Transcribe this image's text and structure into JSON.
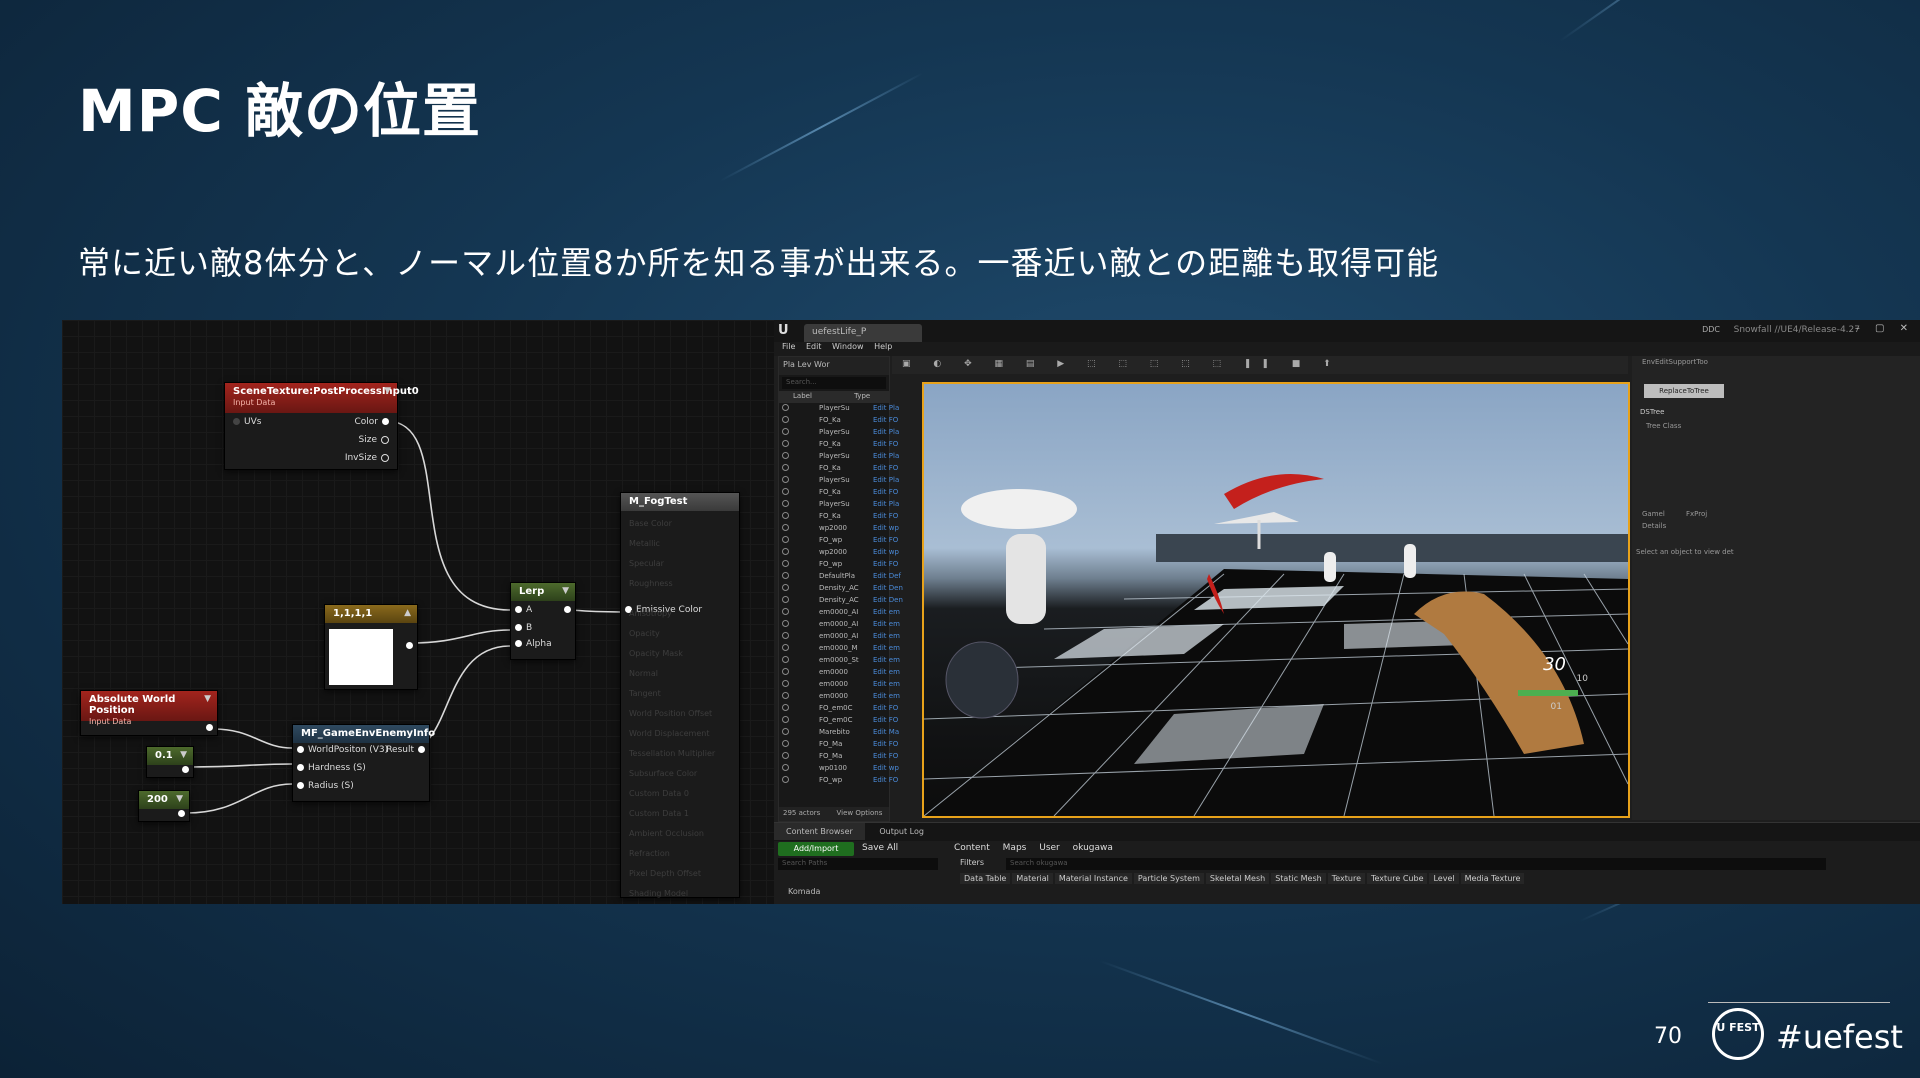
{
  "slide": {
    "title": "MPC 敵の位置",
    "subtitle": "常に近い敵8体分と、ノーマル位置8か所を知る事が出来る。一番近い敵との距離も取得可能",
    "page_number": "70",
    "hashtag": "#uefest",
    "logo_text": "U FEST"
  },
  "material_editor": {
    "scene_texture": {
      "title": "SceneTexture:PostProcessInput0",
      "subtitle": "Input Data",
      "in_uvs": "UVs",
      "out_color": "Color",
      "out_size": "Size",
      "out_invsize": "InvSize"
    },
    "constant_vec": {
      "title": "1,1,1,1"
    },
    "lerp": {
      "title": "Lerp",
      "pin_a": "A",
      "pin_b": "B",
      "pin_alpha": "Alpha"
    },
    "fog_material": {
      "title": "M_FogTest",
      "emissive": "Emissive Color",
      "dim_pins": [
        "Base Color",
        "Metallic",
        "Specular",
        "Roughness",
        "Anisotropy",
        "Opacity",
        "Opacity Mask",
        "Normal",
        "Tangent",
        "World Position Offset",
        "World Displacement",
        "Tessellation Multiplier",
        "Subsurface Color",
        "Custom Data 0",
        "Custom Data 1",
        "Ambient Occlusion",
        "Refraction",
        "Pixel Depth Offset",
        "Shading Model"
      ]
    },
    "absolute_world_position": {
      "title": "Absolute World Position",
      "subtitle": "Input Data"
    },
    "mf_enemy_info": {
      "title": "MF_GameEnvEnemyInfo",
      "pin_world_pos": "WorldPositon (V3)",
      "pin_result": "Result",
      "pin_hardness": "Hardness (S)",
      "pin_radius": "Radius (S)"
    },
    "const_hardness": "0.1",
    "const_radius": "200"
  },
  "ue_editor": {
    "logo": "U",
    "tab": "uefestLife_P",
    "release": "Snowfall //UE4/Release-4.27",
    "ddc": "DDC",
    "window_controls": "– ▢ ✕",
    "menu": [
      "File",
      "Edit",
      "Window",
      "Help"
    ],
    "outliner": {
      "toolbar": "Pla  Lev  Wor",
      "search_placeholder": "Search...",
      "col_label": "Label",
      "col_type": "Type",
      "rows": [
        {
          "label": "PlayerSu",
          "type": "Edit Pla"
        },
        {
          "label": "FO_Ka",
          "type": "Edit FO"
        },
        {
          "label": "PlayerSu",
          "type": "Edit Pla"
        },
        {
          "label": "FO_Ka",
          "type": "Edit FO"
        },
        {
          "label": "PlayerSu",
          "type": "Edit Pla"
        },
        {
          "label": "FO_Ka",
          "type": "Edit FO"
        },
        {
          "label": "PlayerSu",
          "type": "Edit Pla"
        },
        {
          "label": "FO_Ka",
          "type": "Edit FO"
        },
        {
          "label": "PlayerSu",
          "type": "Edit Pla"
        },
        {
          "label": "FO_Ka",
          "type": "Edit FO"
        },
        {
          "label": "wp2000",
          "type": "Edit wp"
        },
        {
          "label": "FO_wp",
          "type": "Edit FO"
        },
        {
          "label": "wp2000",
          "type": "Edit wp"
        },
        {
          "label": "FO_wp",
          "type": "Edit FO"
        },
        {
          "label": "DefaultPla",
          "type": "Edit Def"
        },
        {
          "label": "Density_AC",
          "type": "Edit Den"
        },
        {
          "label": "Density_AC",
          "type": "Edit Den"
        },
        {
          "label": "em0000_AI",
          "type": "Edit em"
        },
        {
          "label": "em0000_AI",
          "type": "Edit em"
        },
        {
          "label": "em0000_AI",
          "type": "Edit em"
        },
        {
          "label": "em0000_M",
          "type": "Edit em"
        },
        {
          "label": "em0000_St",
          "type": "Edit em"
        },
        {
          "label": "em0000",
          "type": "Edit em"
        },
        {
          "label": "em0000",
          "type": "Edit em"
        },
        {
          "label": "em0000",
          "type": "Edit em"
        },
        {
          "label": "FO_em0C",
          "type": "Edit FO"
        },
        {
          "label": "FO_em0C",
          "type": "Edit FO"
        },
        {
          "label": "Marebito",
          "type": "Edit Ma"
        },
        {
          "label": "FO_Ma",
          "type": "Edit FO"
        },
        {
          "label": "FO_Ma",
          "type": "Edit FO"
        },
        {
          "label": "wp0100",
          "type": "Edit wp"
        },
        {
          "label": "FO_wp",
          "type": "Edit FO"
        }
      ],
      "actor_count": "295 actors",
      "view_options": "View Options"
    },
    "details": {
      "top_tab": "EnvEditSupportToo",
      "button": "ReplaceToTree",
      "section": "DSTree",
      "field": "Tree Class",
      "tab_a": "Gamel",
      "tab_b": "FxProj",
      "tab_c": "Details",
      "empty_msg": "Select an object to view det"
    },
    "hud": {
      "ammo": "30",
      "sub_a": "10",
      "sub_b": "01"
    },
    "content_browser": {
      "tab_content": "Content Browser",
      "tab_output": "Output Log",
      "add_import": "Add/Import",
      "save_all": "Save All",
      "crumbs": [
        "Content",
        "Maps",
        "User",
        "okugawa"
      ],
      "path_search": "Search Paths",
      "filters": "Filters",
      "asset_search": "Search okugawa",
      "filter_chips": [
        "Data Table",
        "Material",
        "Material Instance",
        "Particle System",
        "Skeletal Mesh",
        "Static Mesh",
        "Texture",
        "Texture Cube",
        "Level",
        "Media Texture"
      ],
      "folder": "Komada"
    }
  },
  "colors": {
    "accent_orange": "#e8a21a",
    "node_red": "#a3241d",
    "add_green": "#1f6e1f",
    "link_blue": "#4a8ad8"
  }
}
